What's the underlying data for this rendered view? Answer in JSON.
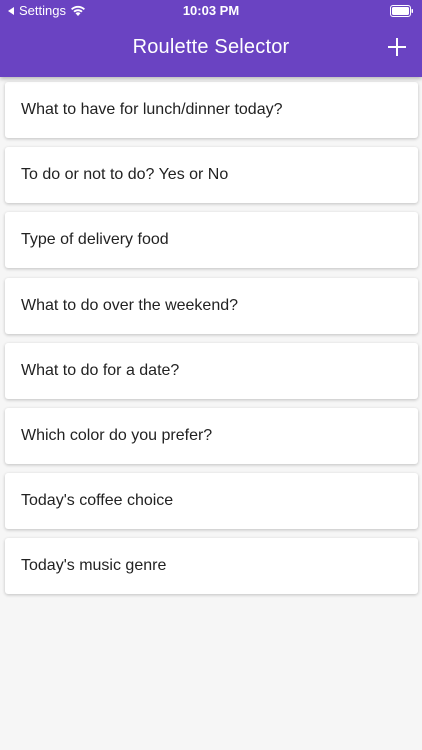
{
  "status_bar": {
    "back_label": "Settings",
    "time": "10:03 PM",
    "icons": [
      "back-arrow-icon",
      "wifi-icon",
      "battery-icon"
    ]
  },
  "app_bar": {
    "title": "Roulette Selector",
    "add_icon": "plus-icon"
  },
  "colors": {
    "primary": "#6a43c2",
    "background": "#f6f6f6",
    "card": "#ffffff",
    "text": "#222222"
  },
  "roulettes": [
    {
      "label": "What to have for lunch/dinner today?"
    },
    {
      "label": "To do or not to do? Yes or No"
    },
    {
      "label": "Type of delivery food"
    },
    {
      "label": "What to do over the weekend?"
    },
    {
      "label": "What to do for a date?"
    },
    {
      "label": "Which color do you prefer?"
    },
    {
      "label": "Today's coffee choice"
    },
    {
      "label": "Today's music genre"
    }
  ]
}
